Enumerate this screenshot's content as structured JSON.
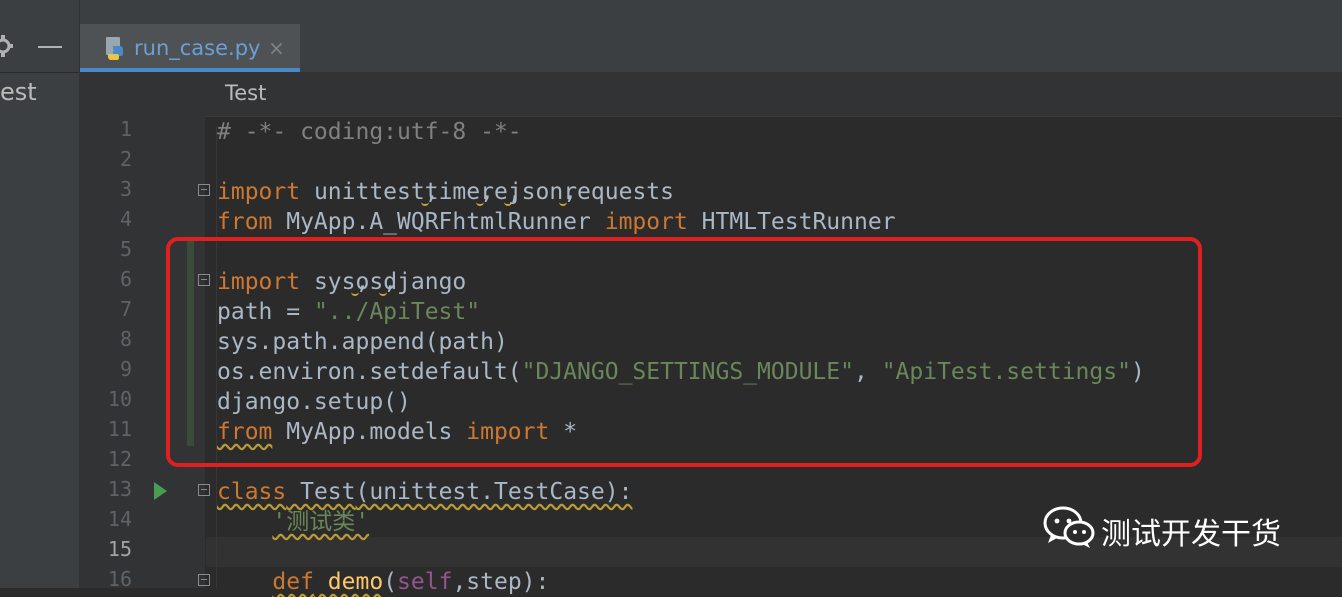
{
  "left_panel": {
    "partial_label": "est"
  },
  "tab": {
    "filename": "run_case.py",
    "close_glyph": "×",
    "icon": "python-file-icon"
  },
  "breadcrumb": {
    "label": "Test"
  },
  "gutter": {
    "line_numbers": [
      "1",
      "2",
      "3",
      "4",
      "5",
      "6",
      "7",
      "8",
      "9",
      "10",
      "11",
      "12",
      "13",
      "14",
      "15",
      "16"
    ],
    "current_line": "15"
  },
  "code": {
    "l1": {
      "comment": "# -*- coding:utf-8 -*-"
    },
    "l3": {
      "kw": "import",
      "a": " unittest",
      "b": "time",
      "c": "re",
      "d": "json",
      "e": "requests"
    },
    "l4": {
      "kw1": "from",
      "mod": " MyApp.A_WQRFhtmlRunner ",
      "kw2": "import",
      "name": " HTMLTestRunner"
    },
    "l6": {
      "kw": "import",
      "a": " sys",
      "b": "os",
      "c": "django"
    },
    "l7": {
      "lhs": "path = ",
      "str": "\"../ApiTest\""
    },
    "l8": {
      "text": "sys.path.append(path)"
    },
    "l9": {
      "pre": "os.environ.setdefault(",
      "s1": "\"DJANGO_SETTINGS_MODULE\"",
      "mid": ", ",
      "s2": "\"ApiTest.settings\"",
      "post": ")"
    },
    "l10": {
      "text": "django.setup()"
    },
    "l11": {
      "kw1": "from",
      "mod": " MyApp.models ",
      "kw2": "import",
      "rest": " *"
    },
    "l13": {
      "kw": "class",
      "name": " Test",
      "rest": "(unittest.TestCase):"
    },
    "l14": {
      "indent": "    ",
      "doc": "'测试类'"
    },
    "l16": {
      "indent": "    ",
      "kw": "def",
      "fn": " demo",
      "open": "(",
      "self": "self",
      "rest": ",step):"
    }
  },
  "watermark": {
    "text": "测试开发干货",
    "icon": "wechat-icon"
  },
  "colors": {
    "keyword": "#cc7832",
    "string": "#6a8759",
    "comment": "#808080",
    "text": "#a9b7c6",
    "highlight_box": "#e02020",
    "tab_underline": "#4a88c7"
  }
}
